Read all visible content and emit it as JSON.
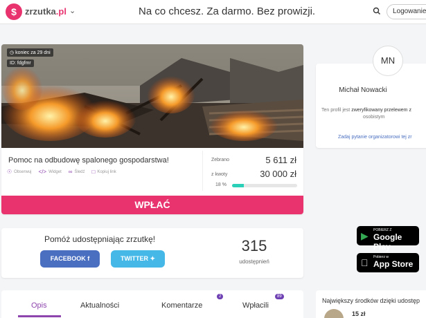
{
  "header": {
    "logo_letter": "$",
    "logo_name": "zrzutka",
    "logo_tld": ".pl",
    "tagline": "Na co chcesz. Za darmo. Bez prowizji.",
    "login_label": "Logowanie / R"
  },
  "campaign": {
    "badge_deadline": "koniec za 29 dni",
    "badge_id": "ID: fdgfmr",
    "title": "Pomoc na odbudowę spalonego gospodarstwa!",
    "actions": [
      "Obserwuj",
      "Widget",
      "Śledź",
      "Kopiuj link"
    ],
    "raised_label": "Zebrano",
    "raised_value": "5 611 zł",
    "goal_label": "z kwoty",
    "goal_value": "30 000 zł",
    "percent_label": "18 %",
    "progress": 0.18,
    "donate_label": "WPŁAĆ"
  },
  "share": {
    "title": "Pomóż udostępniając zrzutkę!",
    "facebook_label": "FACEBOOK",
    "twitter_label": "TWITTER",
    "count": "315",
    "count_label": "udostępnień"
  },
  "tabs": [
    {
      "label": "Opis",
      "badge": ""
    },
    {
      "label": "Aktualności",
      "badge": ""
    },
    {
      "label": "Komentarze",
      "badge": "2"
    },
    {
      "label": "Wpłacili",
      "badge": "89"
    }
  ],
  "organizer": {
    "initials": "MN",
    "name": "Michał Nowacki",
    "verified_prefix": "Ten profil jest",
    "verified_text": "zweryfikowany przelewem z",
    "verified_suffix": "osobistym",
    "ask_label": "Zadaj pytanie organizatorowi tej zr"
  },
  "stores": {
    "google_small": "POBIERZ Z",
    "google_big": "Google Play",
    "apple_small": "Pobierz w",
    "apple_big": "App Store"
  },
  "donors": {
    "title": "Największy środków dzięki udostęp",
    "first_amount": "15 zł"
  },
  "colors": {
    "brand": "#e8336f",
    "accent": "#8e44ad",
    "progress": "#2ad0b8",
    "facebook": "#4a6fc0",
    "twitter": "#46b8e8"
  }
}
